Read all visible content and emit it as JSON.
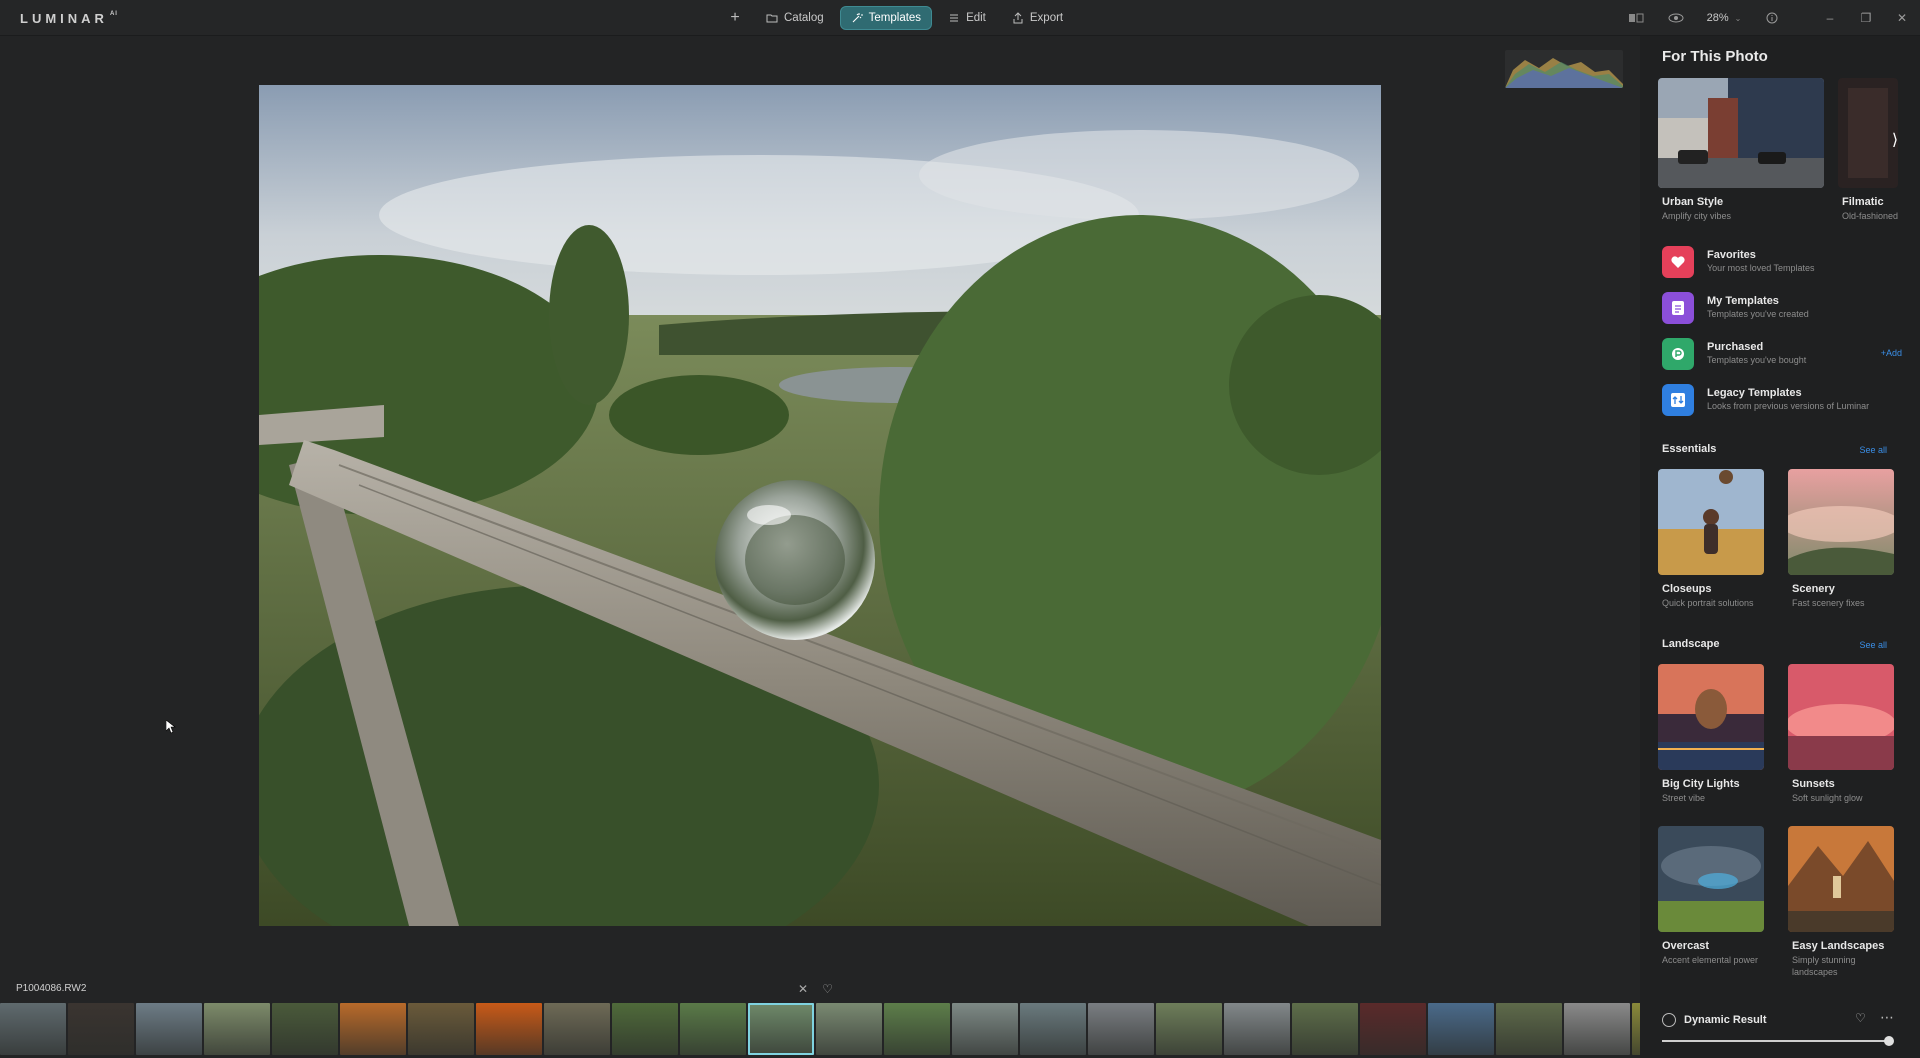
{
  "app": {
    "logo": "LUMINAR",
    "logo_sup": "AI"
  },
  "nav": {
    "catalog": "Catalog",
    "templates": "Templates",
    "edit": "Edit",
    "export": "Export"
  },
  "toolbar": {
    "zoom": "28%"
  },
  "file": {
    "name": "P1004086.RW2"
  },
  "panel": {
    "title": "For This Photo",
    "featured": [
      {
        "name": "Urban Style",
        "sub": "Amplify city vibes"
      },
      {
        "name": "Filmatic",
        "sub": "Old-fashioned"
      }
    ],
    "collections": [
      {
        "name": "Favorites",
        "sub": "Your most loved Templates",
        "color": "#e5405a"
      },
      {
        "name": "My Templates",
        "sub": "Templates you've created",
        "color": "#8b4fd9"
      },
      {
        "name": "Purchased",
        "sub": "Templates you've bought",
        "color": "#2fa86a",
        "action": "+Add"
      },
      {
        "name": "Legacy Templates",
        "sub": "Looks from previous versions of Luminar",
        "color": "#2f7fe0"
      }
    ],
    "essentials": {
      "title": "Essentials",
      "see_all": "See all",
      "items": [
        {
          "name": "Closeups",
          "sub": "Quick portrait solutions"
        },
        {
          "name": "Scenery",
          "sub": "Fast scenery fixes"
        }
      ]
    },
    "landscape": {
      "title": "Landscape",
      "see_all": "See all",
      "items": [
        {
          "name": "Big City Lights",
          "sub": "Street vibe"
        },
        {
          "name": "Sunsets",
          "sub": "Soft sunlight glow"
        },
        {
          "name": "Overcast",
          "sub": "Accent elemental power"
        },
        {
          "name": "Easy Landscapes",
          "sub": "Simply stunning landscapes"
        }
      ]
    }
  },
  "dynamic": {
    "label": "Dynamic Result",
    "amount": 100
  },
  "filmstrip": {
    "selected_index": 11,
    "thumbs": [
      "#5f6a6e",
      "#3a3430",
      "#6d7c86",
      "#7d8b6a",
      "#4a5a3a",
      "#b86a2a",
      "#6a5a3a",
      "#c85a18",
      "#6e6a56",
      "#4f6a3a",
      "#5a7a48",
      "#6f8a6a",
      "#7a8a72",
      "#5d7e4a",
      "#7e8a86",
      "#6a7a7e",
      "#7a7e82",
      "#6e7e5a",
      "#82888a",
      "#5e6e4a",
      "#5a2a2a",
      "#4a6a8a",
      "#5e6a4a",
      "#8a8a8a",
      "#8a8a3a"
    ]
  }
}
